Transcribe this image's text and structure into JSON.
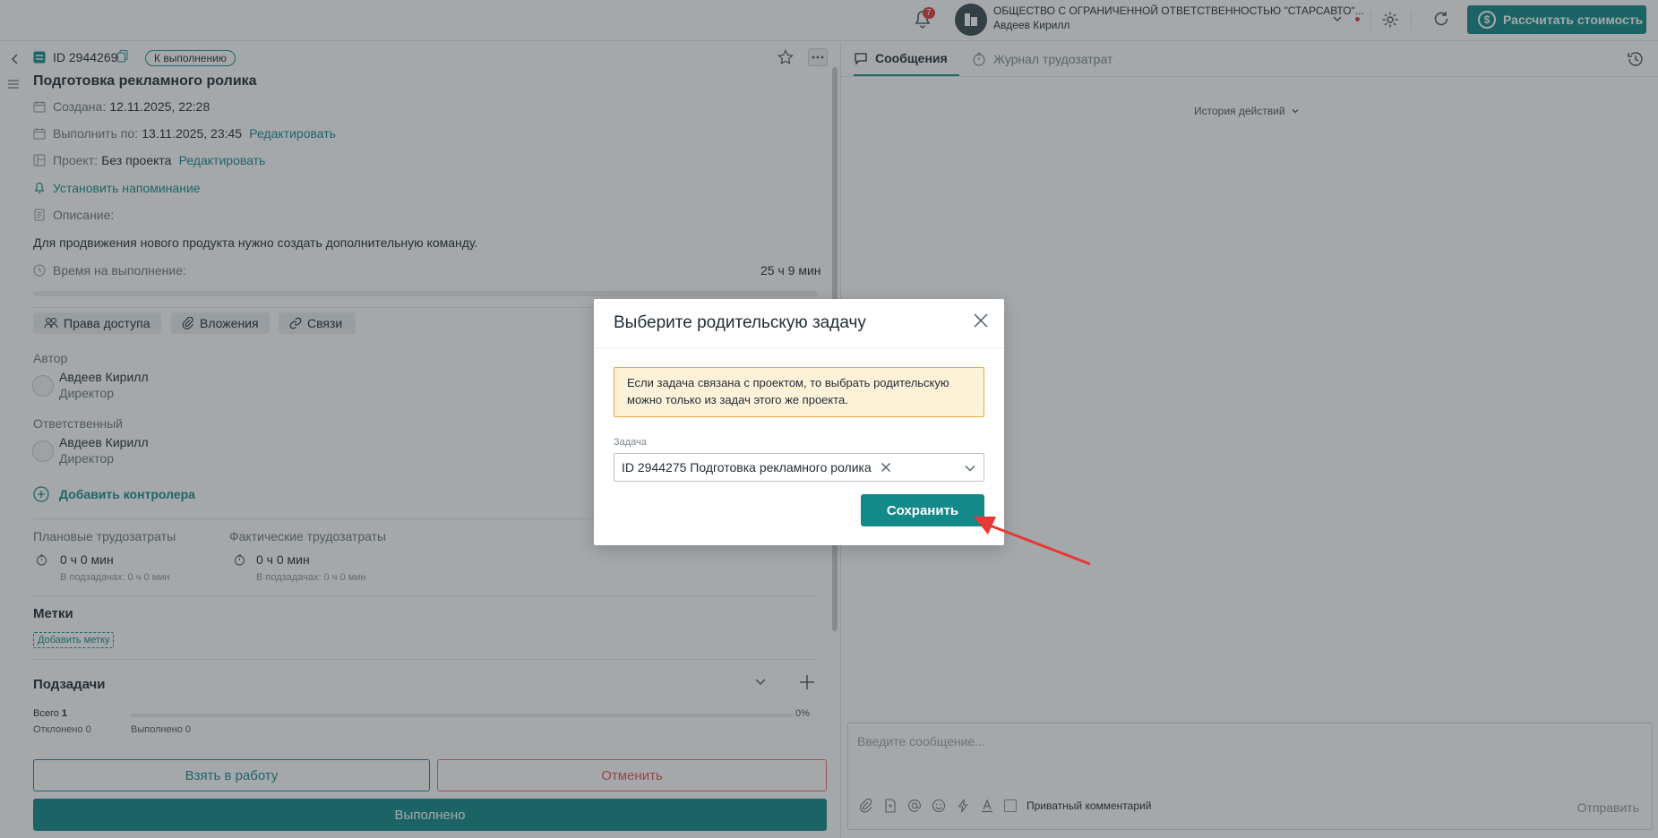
{
  "topbar": {
    "notifications_count": "7",
    "org_name": "ОБЩЕСТВО С ОГРАНИЧЕННОЙ ОТВЕТСТВЕННОСТЬЮ \"СТАРСАВТО\"...",
    "user_name": "Авдеев Кирилл",
    "calc_button": "Рассчитать стоимость"
  },
  "task": {
    "id": "ID 2944269",
    "status": "К выполнению",
    "title": "Подготовка рекламного ролика",
    "created_label": "Создана:",
    "created_value": "12.11.2025, 22:28",
    "due_label": "Выполнить по:",
    "due_value": "13.11.2025, 23:45",
    "edit_link": "Редактировать",
    "project_label": "Проект:",
    "project_value": "Без проекта",
    "reminder_link": "Установить напоминание",
    "description_label": "Описание:",
    "description_text": "Для продвижения нового продукта нужно создать дополнительную команду.",
    "time_label": "Время на выполнение:",
    "time_value": "25 ч 9 мин",
    "pills": [
      "Права доступа",
      "Вложения",
      "Связи"
    ],
    "author_label": "Автор",
    "responsible_label": "Ответственный",
    "person_name": "Авдеев Кирилл",
    "person_role": "Директор",
    "add_controller": "Добавить контролера",
    "planned_label": "Плановые трудозатраты",
    "actual_label": "Фактические трудозатраты",
    "effort_value": "0 ч 0 мин",
    "effort_sub": "В подзадачах: 0 ч 0 мин",
    "tags_title": "Метки",
    "tags_add": "Добавить метку",
    "subtasks_title": "Подзадачи",
    "subtasks_total_label": "Всего",
    "subtasks_total": "1",
    "subtasks_rejected": "Отклонено 0",
    "subtasks_done": "Выполнено 0",
    "subtasks_percent": "0%",
    "btn_take": "Взять в работу",
    "btn_cancel": "Отменить",
    "btn_done": "Выполнено"
  },
  "right": {
    "tab_messages": "Сообщения",
    "tab_journal": "Журнал трудозатрат",
    "history": "История действий",
    "message_placeholder": "Введите сообщение...",
    "private_comment": "Приватный комментарий",
    "send": "Отправить"
  },
  "modal": {
    "title": "Выберите родительскую задачу",
    "warning": "Если задача связана с проектом, то выбрать родительскую можно только из задач этого же проекта.",
    "field_label": "Задача",
    "field_value": "ID 2944275 Подготовка рекламного ролика",
    "save": "Сохранить"
  },
  "colors": {
    "accent": "#14898a",
    "warning_bg": "#fdf1d8",
    "warning_border": "#f0a63b",
    "annotation_arrow": "#e53935"
  }
}
